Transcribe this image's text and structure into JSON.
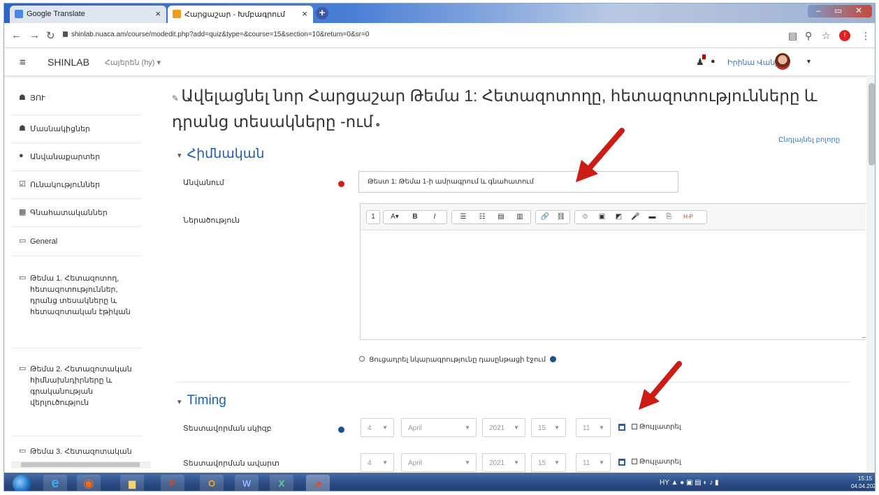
{
  "browser": {
    "tabs": [
      {
        "title": "Google Translate",
        "favicon_color": "#4a86e8"
      },
      {
        "title": "Հարցաշար - Խմբագրում",
        "favicon_color": "#f29b1d"
      }
    ],
    "new_tab_glyph": "+",
    "url": "shinlab.nuaca.am/course/modedit.php?add=quiz&type=&course=15&section=10&return=0&sr=0",
    "profile_initial": "!"
  },
  "navbar": {
    "menu_icon": "≡",
    "brand": "SHINLAB",
    "language": "Հայերեն (hy) ▾",
    "user_name": "Իրինա Վանյան"
  },
  "sidebar": {
    "items": [
      {
        "icon": "dashboard-icon",
        "glyph": "☗",
        "label": "ՅՈՒ"
      },
      {
        "icon": "users-icon",
        "glyph": "☗",
        "label": "Մասնակիցներ"
      },
      {
        "icon": "badge-icon",
        "glyph": "●",
        "label": "Անվանաքարտեր"
      },
      {
        "icon": "competency-icon",
        "glyph": "☑",
        "label": "Ունակություններ"
      },
      {
        "icon": "grades-icon",
        "glyph": "▦",
        "label": "Գնահատականներ"
      },
      {
        "icon": "folder-icon",
        "glyph": "▭",
        "label": "General"
      },
      {
        "icon": "folder-icon",
        "glyph": "▭",
        "label": "Թեմա 1. Հետազոտող, հետազոտություններ, դրանց տեսակները և հետազոտական էթիկան"
      },
      {
        "icon": "folder-icon",
        "glyph": "▭",
        "label": "Թեմա 2. Հետազոտական հիմնախնդիրները և գրականության վերլուծություն"
      },
      {
        "icon": "folder-icon",
        "glyph": "▭",
        "label": "Թեմա 3. Հետազոտական"
      }
    ]
  },
  "main": {
    "title": "Ավելացնել նոր Հարցաշար Թեմա 1: Հետազոտողը, հետազոտությունները և դրանց տեսակները -ում",
    "expand_all": "Ընդլայնել բոլորը",
    "general_section": "Հիմնական",
    "name_label": "Անվանում",
    "name_value": "Թեստ 1: Թեմա 1-ի ամրագրում և գնահատում",
    "description_label": "Ներածություն",
    "editor_tools": [
      "1",
      "A▾",
      "B",
      "I",
      "☰",
      "☷",
      "▤",
      "▥",
      "🔗",
      "⛓",
      "☺",
      "▣",
      "◩",
      "🎤",
      "▬",
      "⎘",
      "H-P"
    ],
    "display_description": "Ցուցադրել նկարագրությունը դասընթացի էջում",
    "timing_section": "Timing",
    "open_label": "Տեստավորման սկիզբ",
    "close_label": "Տեստավորման ավարտ",
    "open_date": {
      "day": "4",
      "month": "April",
      "year": "2021",
      "hour": "15",
      "minute": "11"
    },
    "close_date": {
      "day": "4",
      "month": "April",
      "year": "2021",
      "hour": "15",
      "minute": "11"
    },
    "enable_label": "Թույլատրել"
  },
  "taskbar": {
    "apps": [
      {
        "icon": "ie-icon",
        "glyph": "e",
        "color": "#3fa7f0"
      },
      {
        "icon": "firefox-icon",
        "glyph": "◉",
        "color": "#f26b1d"
      },
      {
        "icon": "explorer-icon",
        "glyph": "▆",
        "color": "#f1d56b"
      },
      {
        "icon": "powerpoint-icon",
        "glyph": "P",
        "color": "#d24726"
      },
      {
        "icon": "outlook-icon",
        "glyph": "O",
        "color": "#f2a12e"
      },
      {
        "icon": "word-icon",
        "glyph": "W",
        "color": "#2b5797"
      },
      {
        "icon": "excel-icon",
        "glyph": "X",
        "color": "#1e7145"
      },
      {
        "icon": "chrome-icon",
        "glyph": "◕",
        "color": "#e8453c"
      }
    ],
    "tray": "HY",
    "time": "15:15",
    "date": "04.04.2021"
  },
  "colors": {
    "accent": "#1f5ea8",
    "link": "#3a73c2",
    "required": "#c8201e",
    "annotation_arrow": "#cc1c15"
  }
}
